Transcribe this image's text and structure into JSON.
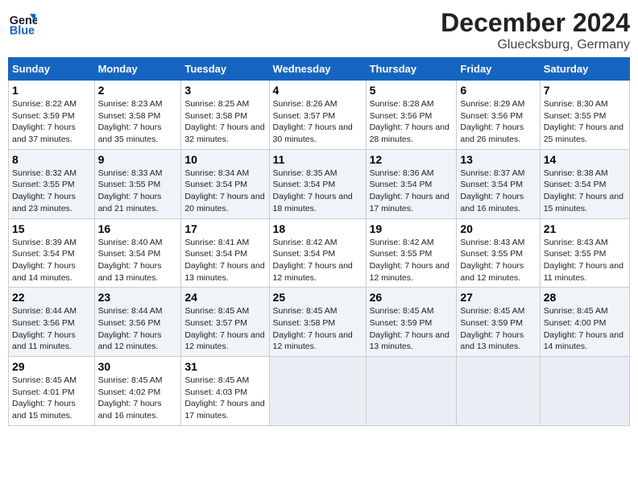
{
  "logo": {
    "line1": "General",
    "line2": "Blue"
  },
  "title": "December 2024",
  "subtitle": "Gluecksburg, Germany",
  "days_header": [
    "Sunday",
    "Monday",
    "Tuesday",
    "Wednesday",
    "Thursday",
    "Friday",
    "Saturday"
  ],
  "weeks": [
    [
      {
        "day": "1",
        "sunrise": "8:22 AM",
        "sunset": "3:59 PM",
        "daylight": "7 hours and 37 minutes."
      },
      {
        "day": "2",
        "sunrise": "8:23 AM",
        "sunset": "3:58 PM",
        "daylight": "7 hours and 35 minutes."
      },
      {
        "day": "3",
        "sunrise": "8:25 AM",
        "sunset": "3:58 PM",
        "daylight": "7 hours and 32 minutes."
      },
      {
        "day": "4",
        "sunrise": "8:26 AM",
        "sunset": "3:57 PM",
        "daylight": "7 hours and 30 minutes."
      },
      {
        "day": "5",
        "sunrise": "8:28 AM",
        "sunset": "3:56 PM",
        "daylight": "7 hours and 28 minutes."
      },
      {
        "day": "6",
        "sunrise": "8:29 AM",
        "sunset": "3:56 PM",
        "daylight": "7 hours and 26 minutes."
      },
      {
        "day": "7",
        "sunrise": "8:30 AM",
        "sunset": "3:55 PM",
        "daylight": "7 hours and 25 minutes."
      }
    ],
    [
      {
        "day": "8",
        "sunrise": "8:32 AM",
        "sunset": "3:55 PM",
        "daylight": "7 hours and 23 minutes."
      },
      {
        "day": "9",
        "sunrise": "8:33 AM",
        "sunset": "3:55 PM",
        "daylight": "7 hours and 21 minutes."
      },
      {
        "day": "10",
        "sunrise": "8:34 AM",
        "sunset": "3:54 PM",
        "daylight": "7 hours and 20 minutes."
      },
      {
        "day": "11",
        "sunrise": "8:35 AM",
        "sunset": "3:54 PM",
        "daylight": "7 hours and 18 minutes."
      },
      {
        "day": "12",
        "sunrise": "8:36 AM",
        "sunset": "3:54 PM",
        "daylight": "7 hours and 17 minutes."
      },
      {
        "day": "13",
        "sunrise": "8:37 AM",
        "sunset": "3:54 PM",
        "daylight": "7 hours and 16 minutes."
      },
      {
        "day": "14",
        "sunrise": "8:38 AM",
        "sunset": "3:54 PM",
        "daylight": "7 hours and 15 minutes."
      }
    ],
    [
      {
        "day": "15",
        "sunrise": "8:39 AM",
        "sunset": "3:54 PM",
        "daylight": "7 hours and 14 minutes."
      },
      {
        "day": "16",
        "sunrise": "8:40 AM",
        "sunset": "3:54 PM",
        "daylight": "7 hours and 13 minutes."
      },
      {
        "day": "17",
        "sunrise": "8:41 AM",
        "sunset": "3:54 PM",
        "daylight": "7 hours and 13 minutes."
      },
      {
        "day": "18",
        "sunrise": "8:42 AM",
        "sunset": "3:54 PM",
        "daylight": "7 hours and 12 minutes."
      },
      {
        "day": "19",
        "sunrise": "8:42 AM",
        "sunset": "3:55 PM",
        "daylight": "7 hours and 12 minutes."
      },
      {
        "day": "20",
        "sunrise": "8:43 AM",
        "sunset": "3:55 PM",
        "daylight": "7 hours and 12 minutes."
      },
      {
        "day": "21",
        "sunrise": "8:43 AM",
        "sunset": "3:55 PM",
        "daylight": "7 hours and 11 minutes."
      }
    ],
    [
      {
        "day": "22",
        "sunrise": "8:44 AM",
        "sunset": "3:56 PM",
        "daylight": "7 hours and 11 minutes."
      },
      {
        "day": "23",
        "sunrise": "8:44 AM",
        "sunset": "3:56 PM",
        "daylight": "7 hours and 12 minutes."
      },
      {
        "day": "24",
        "sunrise": "8:45 AM",
        "sunset": "3:57 PM",
        "daylight": "7 hours and 12 minutes."
      },
      {
        "day": "25",
        "sunrise": "8:45 AM",
        "sunset": "3:58 PM",
        "daylight": "7 hours and 12 minutes."
      },
      {
        "day": "26",
        "sunrise": "8:45 AM",
        "sunset": "3:59 PM",
        "daylight": "7 hours and 13 minutes."
      },
      {
        "day": "27",
        "sunrise": "8:45 AM",
        "sunset": "3:59 PM",
        "daylight": "7 hours and 13 minutes."
      },
      {
        "day": "28",
        "sunrise": "8:45 AM",
        "sunset": "4:00 PM",
        "daylight": "7 hours and 14 minutes."
      }
    ],
    [
      {
        "day": "29",
        "sunrise": "8:45 AM",
        "sunset": "4:01 PM",
        "daylight": "7 hours and 15 minutes."
      },
      {
        "day": "30",
        "sunrise": "8:45 AM",
        "sunset": "4:02 PM",
        "daylight": "7 hours and 16 minutes."
      },
      {
        "day": "31",
        "sunrise": "8:45 AM",
        "sunset": "4:03 PM",
        "daylight": "7 hours and 17 minutes."
      },
      null,
      null,
      null,
      null
    ]
  ],
  "labels": {
    "sunrise": "Sunrise:",
    "sunset": "Sunset:",
    "daylight": "Daylight:"
  }
}
